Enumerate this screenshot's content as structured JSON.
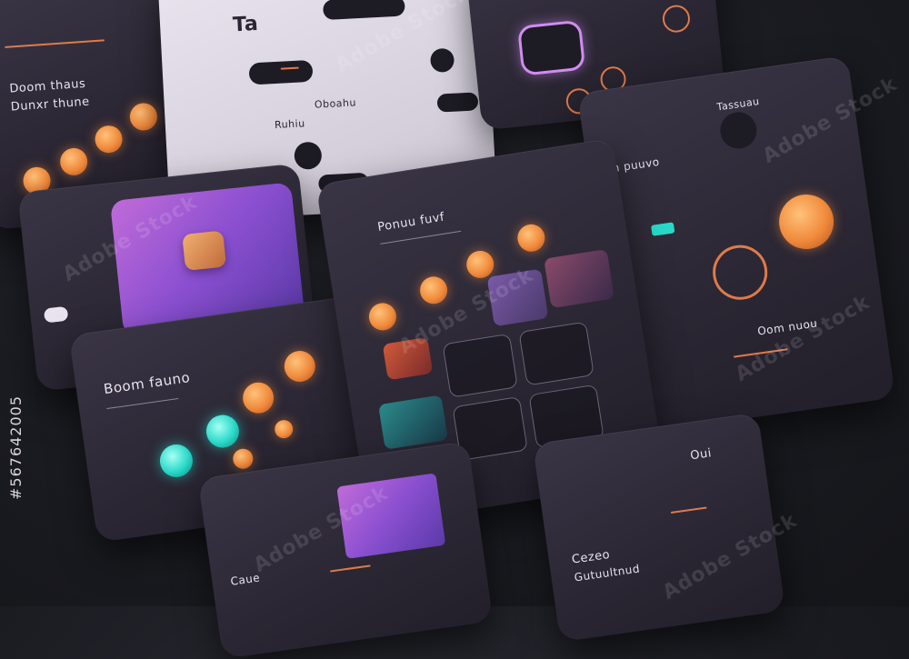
{
  "cards": {
    "top_left": {
      "title_1": "Doom thaus",
      "title_2": "Dunxr thune"
    },
    "top_center": {
      "logo": "Ta",
      "label_a": "Ruhiu",
      "label_b": "Oboahu"
    },
    "top_right": {},
    "right": {
      "header": "Ion puuvo",
      "subtitle": "Tassuau",
      "label": "Oom nuou"
    },
    "mid_left": {
      "title": "Boom fauno"
    },
    "center": {
      "title": "Ponuu fuvf"
    },
    "bottom_center": {
      "label": "Caue"
    },
    "bottom_right": {
      "title_1": "Oui",
      "title_2": "Cezeo",
      "title_3": "Gutuultnud"
    }
  },
  "watermark": "Adobe Stock",
  "stock_id": "#567642005",
  "colors": {
    "accent": "#f08a3c",
    "teal": "#2ad8c8",
    "purple": "#8a4fd0",
    "bg": "#1b1c22"
  }
}
